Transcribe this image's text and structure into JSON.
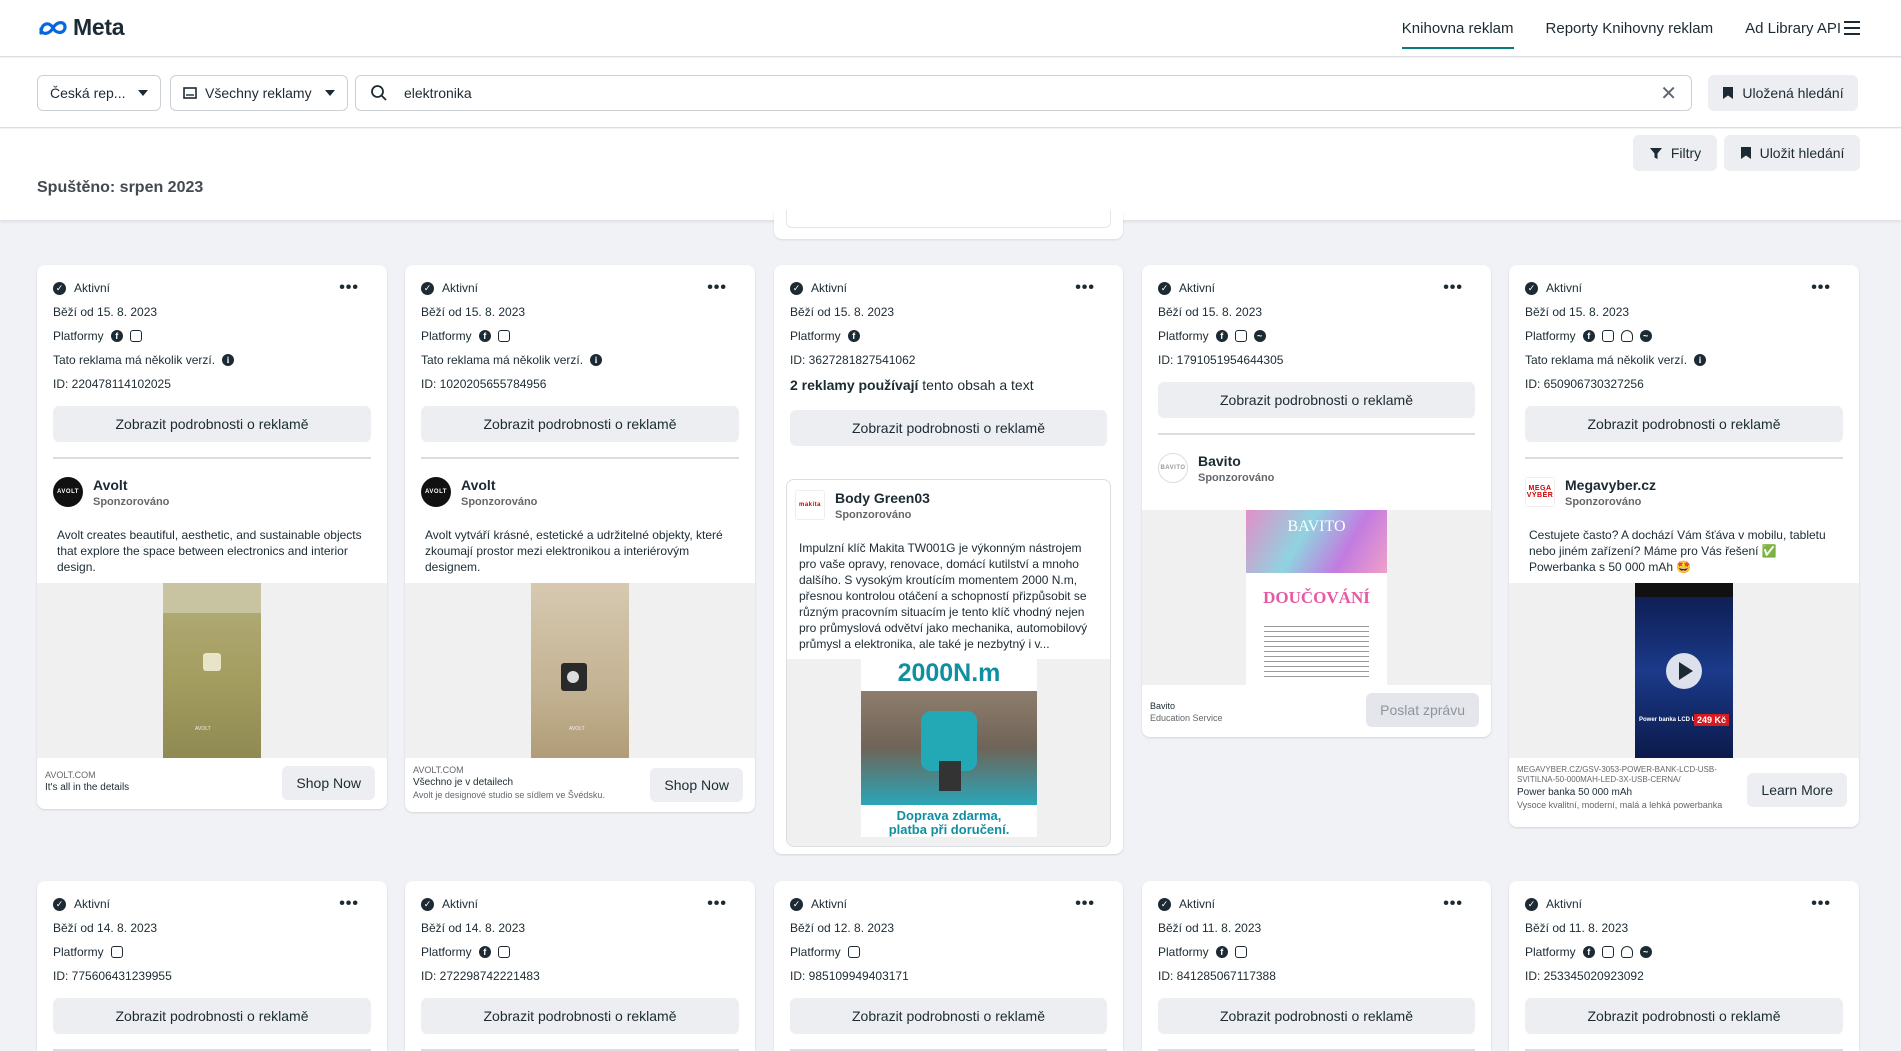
{
  "nav": {
    "logo": "Meta",
    "links": [
      "Knihovna reklam",
      "Reporty Knihovny reklam",
      "Ad Library API"
    ]
  },
  "search": {
    "country": "Česká rep...",
    "ad_type": "Všechny reklamy",
    "query": "elektronika",
    "saved_searches": "Uložená hledání"
  },
  "filters": {
    "filters_label": "Filtry",
    "save_search_label": "Uložit hledání",
    "started_label": "Spuštěno: srpen 2023"
  },
  "common": {
    "active": "Aktivní",
    "platforms": "Platformy",
    "details_button": "Zobrazit podrobnosti o reklamě",
    "multiple_versions": "Tato reklama má několik verzí.",
    "sponsored": "Sponzorováno",
    "uses_bold": "2 reklamy používají",
    "uses_rest": " tento obsah a text"
  },
  "cards_row1": [
    {
      "running": "Běží od 15. 8. 2023",
      "id": "ID: 220478114102025",
      "advertiser": "Avolt",
      "avatar_text": "AVOLT",
      "body": "Avolt creates beautiful, aesthetic, and sustainable objects that explore the space between electronics and interior design.",
      "foot_caption": "AVOLT.COM",
      "foot_title": "It's all in the details",
      "foot_desc": "",
      "cta": "Shop Now",
      "media_label": "AVOLT"
    },
    {
      "running": "Běží od 15. 8. 2023",
      "id": "ID: 1020205655784956",
      "advertiser": "Avolt",
      "avatar_text": "AVOLT",
      "body": "Avolt vytváří krásné, estetické a udržitelné objekty, které zkoumají prostor mezi elektronikou a interiérovým designem.",
      "foot_caption": "AVOLT.COM",
      "foot_title": "Všechno je v detailech",
      "foot_desc": "Avolt je designové studio se sídlem ve Švédsku.",
      "cta": "Shop Now",
      "media_label": "AVOLT"
    },
    {
      "running": "Běží od 15. 8. 2023",
      "id": "ID: 3627281827541062",
      "advertiser": "Body Green03",
      "avatar_text": "makita",
      "body": "Impulzní klíč Makita TW001G je výkonným nástrojem pro vaše opravy, renovace, domácí kutilství a mnoho dalšího. S vysokým kroutícím momentem 2000 N.m, přesnou kontrolou otáčení a schopností přizpůsobit se různým pracovním situacím je tento klíč vhodný nejen pro průmyslová odvětví jako mechanika, automobilový průmysl a elektronika, ale také je nezbytný i v...",
      "media_headline": "2000N.m",
      "media_footer_1": "Doprava zdarma,",
      "media_footer_2": "platba při doručení."
    },
    {
      "running": "Běží od 15. 8. 2023",
      "id": "ID: 1791051954644305",
      "advertiser": "Bavito",
      "avatar_text": "BAVITO",
      "foot_caption": "Bavito",
      "foot_title": "Education Service",
      "cta": "Poslat zprávu",
      "media_title": "BAVITO",
      "media_sub": "DOUČOVÁNÍ"
    },
    {
      "running": "Běží od 15. 8. 2023",
      "id": "ID: 650906730327256",
      "advertiser": "Megavyber.cz",
      "avatar_text": "MEGA VÝBĚR",
      "body": "Cestujete často? A dochází Vám šťáva v mobilu, tabletu nebo jiném zařízení? Máme pro Vás řešení ✅ Powerbanka s 50 000 mAh 🤩",
      "foot_caption": "MEGAVYBER.CZ/GSV-3053-POWER-BANK-LCD-USB-SVITILNA-50-000MAH-LED-3X-USB-CERNA/",
      "foot_title": "Power banka 50 000 mAh",
      "foot_desc": "Vysoce kvalitní, moderní, malá a lehká powerbanka",
      "cta": "Learn More",
      "media_price": "249 Kč",
      "media_caption": "Power banka LCD USB"
    }
  ],
  "cards_row2": [
    {
      "running": "Běží od 14. 8. 2023",
      "id": "ID: 775606431239955"
    },
    {
      "running": "Běží od 14. 8. 2023",
      "id": "ID: 272298742221483"
    },
    {
      "running": "Běží od 12. 8. 2023",
      "id": "ID: 985109949403171"
    },
    {
      "running": "Běží od 11. 8. 2023",
      "id": "ID: 841285067117388"
    },
    {
      "running": "Běží od 11. 8. 2023",
      "id": "ID: 253345020923092"
    }
  ]
}
